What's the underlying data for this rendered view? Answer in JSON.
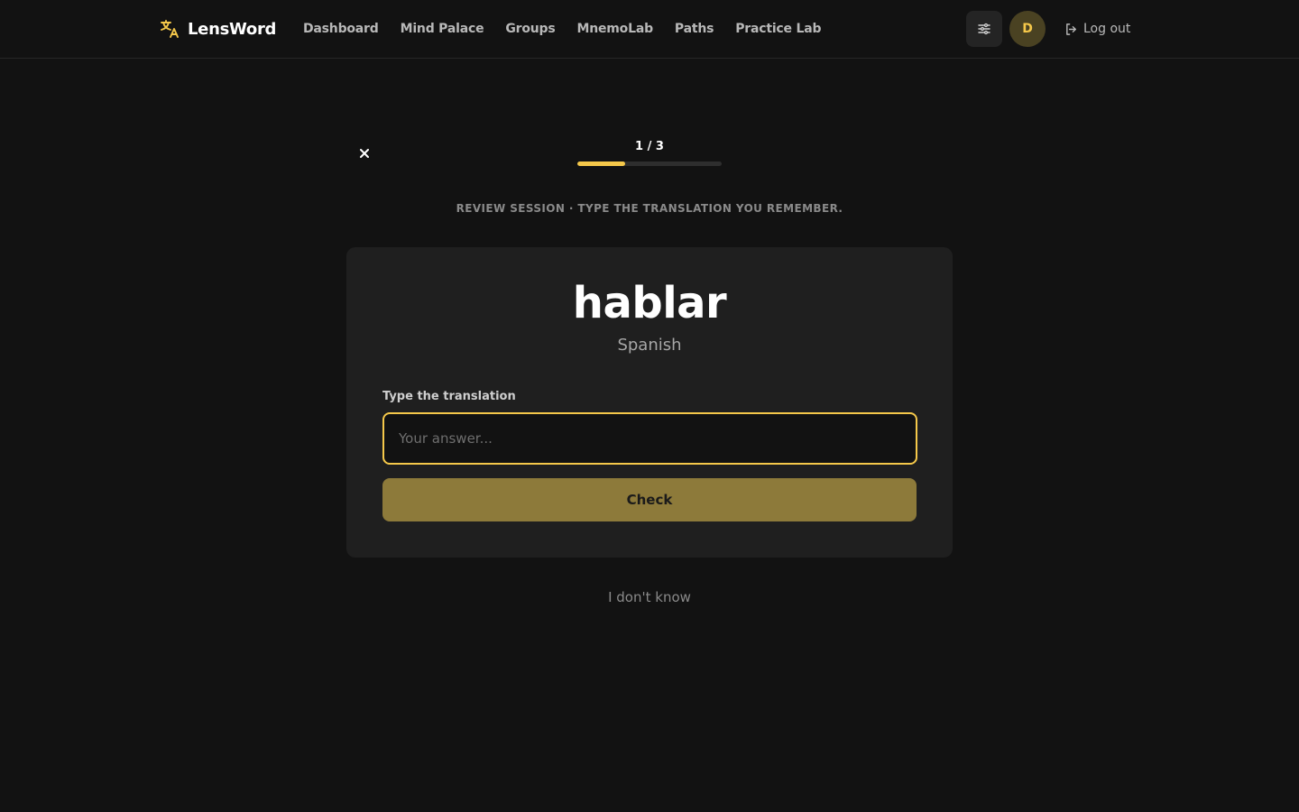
{
  "app": {
    "name": "LensWord"
  },
  "nav": {
    "items": [
      {
        "label": "Dashboard"
      },
      {
        "label": "Mind Palace"
      },
      {
        "label": "Groups"
      },
      {
        "label": "MnemoLab"
      },
      {
        "label": "Paths"
      },
      {
        "label": "Practice Lab"
      }
    ]
  },
  "header": {
    "avatar_initial": "D",
    "logout_label": "Log out"
  },
  "session": {
    "progress_text": "1 / 3",
    "progress_current": 1,
    "progress_total": 3,
    "instructions": "REVIEW SESSION · TYPE THE TRANSLATION YOU REMEMBER."
  },
  "card": {
    "word": "hablar",
    "language": "Spanish",
    "field_label": "Type the translation",
    "input_value": "",
    "input_placeholder": "Your answer...",
    "check_label": "Check"
  },
  "footer": {
    "dont_know_label": "I don't know"
  },
  "colors": {
    "accent": "#f5c84a",
    "check_button": "#8d7a3a",
    "background": "#121212",
    "card": "#1f1f1f"
  },
  "icons": {
    "brand": "translate-icon",
    "settings": "sliders-icon",
    "logout": "logout-icon",
    "close": "close-icon"
  }
}
